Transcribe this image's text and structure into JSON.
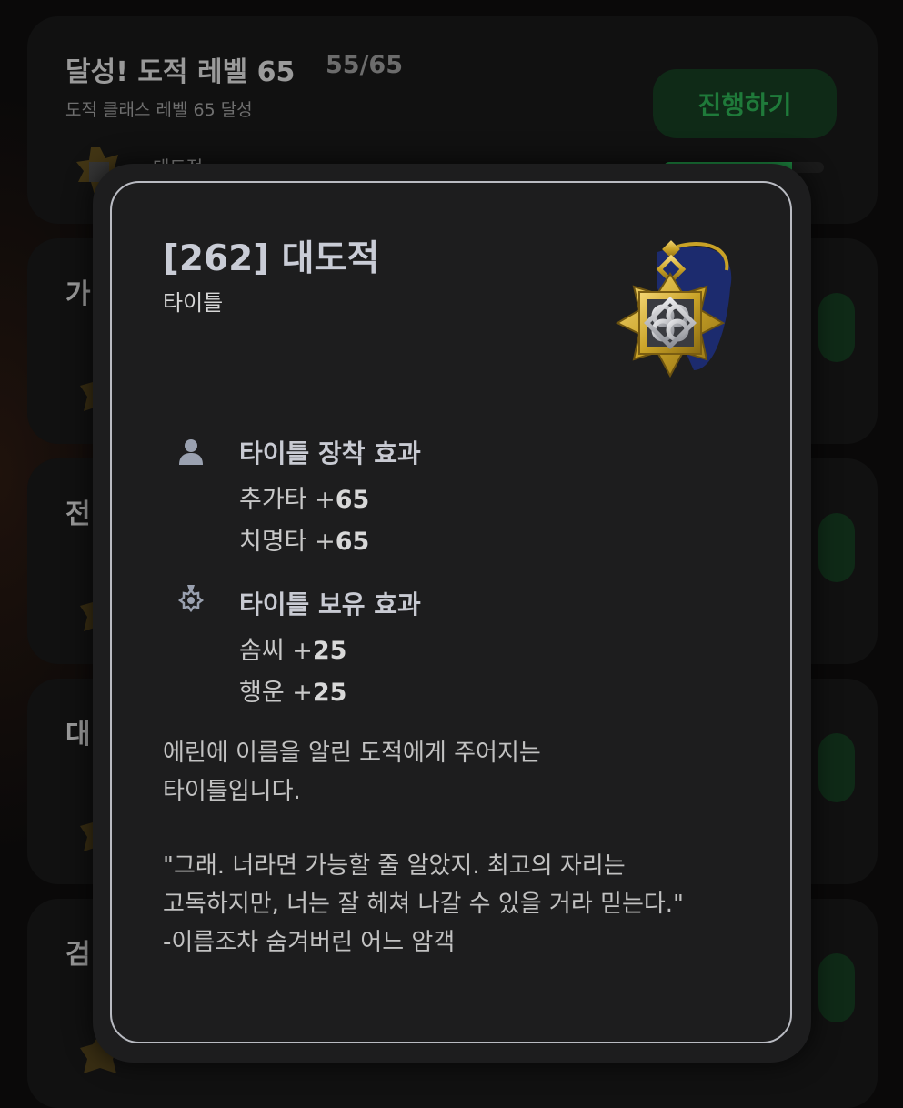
{
  "background_cards": [
    {
      "title": "달성! 도적 레벨 65",
      "progress": "55/65",
      "subtitle": "도적 클래스 레벨 65 달성",
      "reward": "대도적",
      "button": "진행하기",
      "bar_fraction": 0.8
    },
    {
      "title": "가"
    },
    {
      "title": "전"
    },
    {
      "title": "대"
    },
    {
      "title": "검"
    }
  ],
  "modal": {
    "title": "[262] 대도적",
    "type": "타이틀",
    "equip": {
      "icon": "person-icon",
      "heading": "타이틀 장착 효과",
      "stats": [
        {
          "label": "추가타 +",
          "value": "65"
        },
        {
          "label": "치명타 +",
          "value": "65"
        }
      ]
    },
    "own": {
      "icon": "medal-icon",
      "heading": "타이틀 보유 효과",
      "stats": [
        {
          "label": "솜씨 +",
          "value": "25"
        },
        {
          "label": "행운 +",
          "value": "25"
        }
      ]
    },
    "description": "에린에 이름을 알린 도적에게 주어지는\n타이틀입니다.",
    "quote": "\"그래. 너라면 가능할 줄 알았지. 최고의 자리는\n고독하지만, 너는 잘 헤쳐 나갈 수 있을 거라 믿는다.\"\n-이름조차 숨겨버린 어느 암객"
  },
  "colors": {
    "accent_green": "#1e8a42",
    "modal_bg": "#1d1d1e",
    "modal_border": "#b9bbc2",
    "gold": "#c9a227",
    "navy": "#1c2b6e"
  }
}
